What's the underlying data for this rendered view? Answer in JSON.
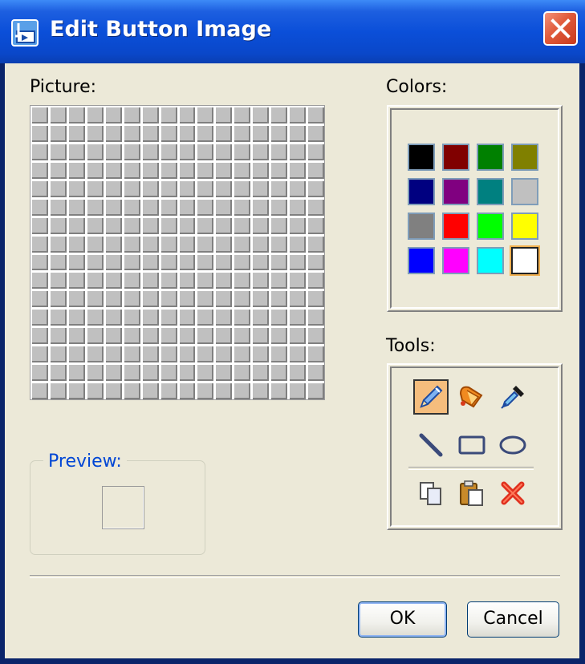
{
  "window": {
    "title": "Edit Button Image",
    "title_icon": "button-editor-icon",
    "close_icon": "close-icon"
  },
  "labels": {
    "picture": "Picture:",
    "colors": "Colors:",
    "tools": "Tools:",
    "preview": "Preview:"
  },
  "picture": {
    "rows": 16,
    "cols": 16,
    "fill": "#c0c0c0"
  },
  "colors": {
    "palette": [
      "#000000",
      "#800000",
      "#008000",
      "#808000",
      "#000080",
      "#800080",
      "#008080",
      "#c0c0c0",
      "#808080",
      "#ff0000",
      "#00ff00",
      "#ffff00",
      "#0000ff",
      "#ff00ff",
      "#00ffff",
      "#ffffff"
    ],
    "selected_index": 15
  },
  "tools": [
    {
      "icon": "pencil-icon",
      "selected": true
    },
    {
      "icon": "fill-bucket-icon",
      "selected": false
    },
    {
      "icon": "eyedropper-icon",
      "selected": false
    },
    {
      "icon": "line-icon",
      "selected": false
    },
    {
      "icon": "rectangle-icon",
      "selected": false
    },
    {
      "icon": "ellipse-icon",
      "selected": false
    },
    {
      "icon": "copy-icon",
      "selected": false
    },
    {
      "icon": "paste-icon",
      "selected": false
    },
    {
      "icon": "clear-icon",
      "selected": false
    }
  ],
  "buttons": {
    "ok": "OK",
    "cancel": "Cancel"
  }
}
